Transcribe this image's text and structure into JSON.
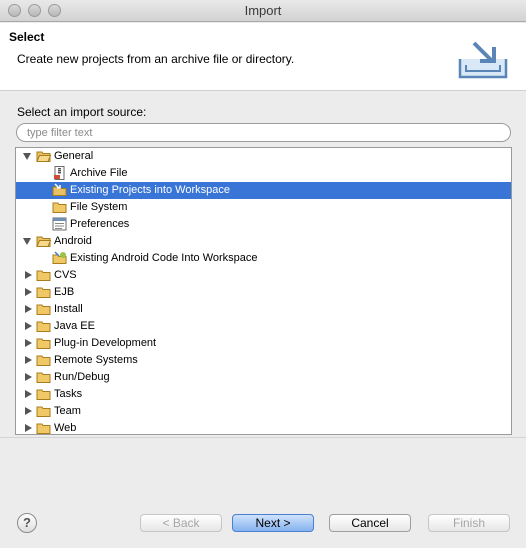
{
  "window": {
    "title": "Import"
  },
  "header": {
    "title": "Select",
    "description": "Create new projects from an archive file or directory."
  },
  "source": {
    "label": "Select an import source:",
    "filter_placeholder": "type filter text",
    "filter_value": ""
  },
  "tree": {
    "items": [
      {
        "label": "General",
        "expanded": true,
        "icon": "folder-open-icon"
      },
      {
        "label": "Archive File",
        "icon": "archive-file-icon"
      },
      {
        "label": "Existing Projects into Workspace",
        "icon": "existing-projects-icon",
        "selected": true
      },
      {
        "label": "File System",
        "icon": "folder-icon"
      },
      {
        "label": "Preferences",
        "icon": "preferences-icon"
      },
      {
        "label": "Android",
        "expanded": true,
        "icon": "folder-open-icon"
      },
      {
        "label": "Existing Android Code Into Workspace",
        "icon": "android-import-icon"
      },
      {
        "label": "CVS",
        "icon": "folder-icon"
      },
      {
        "label": "EJB",
        "icon": "folder-icon"
      },
      {
        "label": "Install",
        "icon": "folder-icon"
      },
      {
        "label": "Java EE",
        "icon": "folder-icon"
      },
      {
        "label": "Plug-in Development",
        "icon": "folder-icon"
      },
      {
        "label": "Remote Systems",
        "icon": "folder-icon"
      },
      {
        "label": "Run/Debug",
        "icon": "folder-icon"
      },
      {
        "label": "Tasks",
        "icon": "folder-icon"
      },
      {
        "label": "Team",
        "icon": "folder-icon"
      },
      {
        "label": "Web",
        "icon": "folder-icon"
      }
    ]
  },
  "buttons": {
    "back": "< Back",
    "next": "Next >",
    "cancel": "Cancel",
    "finish": "Finish",
    "help": "?"
  },
  "colors": {
    "selection": "#3875d7",
    "default_button": "#86b2ef"
  }
}
